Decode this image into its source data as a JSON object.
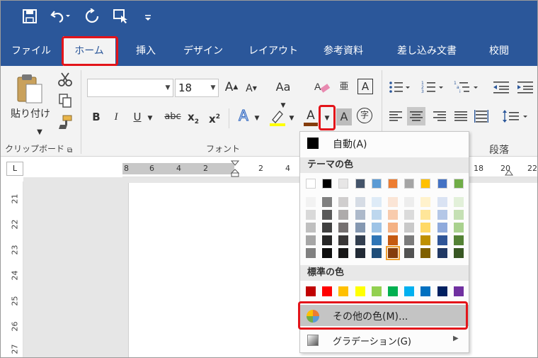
{
  "quick_access": {
    "save_icon": "save-icon",
    "undo_icon": "undo-icon",
    "redo_icon": "redo-icon",
    "touch_icon": "touch-mode-icon",
    "customize_icon": "customize-icon"
  },
  "tabs": [
    {
      "label": "ファイル",
      "active": false
    },
    {
      "label": "ホーム",
      "active": true
    },
    {
      "label": "挿入",
      "active": false
    },
    {
      "label": "デザイン",
      "active": false
    },
    {
      "label": "レイアウト",
      "active": false
    },
    {
      "label": "参考資料",
      "active": false
    },
    {
      "label": "差し込み文書",
      "active": false
    },
    {
      "label": "校閲",
      "active": false
    }
  ],
  "clipboard": {
    "paste_label": "貼り付け",
    "group_label": "クリップボード"
  },
  "font": {
    "font_name": "",
    "font_size": "18",
    "bold": "B",
    "italic": "I",
    "underline": "U",
    "strike": "abc",
    "subscript": "x",
    "subscript_mark": "2",
    "superscript": "x",
    "superscript_mark": "2",
    "change_case": "Aa",
    "grow": "A",
    "shrink": "A",
    "font_color_letter": "A",
    "char_shading_letter": "A",
    "enclosed_char": "字",
    "phonetic": "亜",
    "group_label": "フォント"
  },
  "paragraph": {
    "group_label": "段落"
  },
  "ruler": {
    "left_numbers": [
      "8",
      "6",
      "4",
      "2"
    ],
    "right_numbers": [
      "2",
      "4",
      "18",
      "20",
      "22"
    ],
    "vertical_numbers": [
      "21",
      "22",
      "23",
      "24",
      "25",
      "26",
      "27"
    ],
    "corner_symbol": "L"
  },
  "color_menu": {
    "automatic_label": "自動(A)",
    "theme_header": "テーマの色",
    "standard_header": "標準の色",
    "more_colors_label": "その他の色(M)...",
    "gradient_label": "グラデーション(G)",
    "theme_top": [
      "#ffffff",
      "#000000",
      "#e7e6e6",
      "#44546a",
      "#5b9bd5",
      "#ed7d31",
      "#a5a5a5",
      "#ffc000",
      "#4472c4",
      "#70ad47"
    ],
    "theme_shades": [
      [
        "#f2f2f2",
        "#808080",
        "#d0cece",
        "#d6dce5",
        "#deebf7",
        "#fbe5d6",
        "#ededed",
        "#fff2cc",
        "#dae3f3",
        "#e2f0d9"
      ],
      [
        "#d9d9d9",
        "#595959",
        "#aeabab",
        "#adb9ca",
        "#bdd7ee",
        "#f8cbad",
        "#dbdbdb",
        "#ffe699",
        "#b4c7e7",
        "#c5e0b4"
      ],
      [
        "#bfbfbf",
        "#404040",
        "#767171",
        "#8497b0",
        "#9dc3e6",
        "#f4b183",
        "#c9c9c9",
        "#ffd966",
        "#8faadc",
        "#a9d18e"
      ],
      [
        "#a6a6a6",
        "#262626",
        "#3a3838",
        "#333f50",
        "#2e75b6",
        "#c55a11",
        "#7b7b7b",
        "#bf9000",
        "#2f5597",
        "#548235"
      ],
      [
        "#808080",
        "#0d0d0d",
        "#171616",
        "#222a35",
        "#1f4e79",
        "#843c0c",
        "#525252",
        "#7f6000",
        "#203864",
        "#385723"
      ]
    ],
    "standard": [
      "#c00000",
      "#ff0000",
      "#ffc000",
      "#ffff00",
      "#92d050",
      "#00b050",
      "#00b0f0",
      "#0070c0",
      "#002060",
      "#7030a0"
    ]
  }
}
